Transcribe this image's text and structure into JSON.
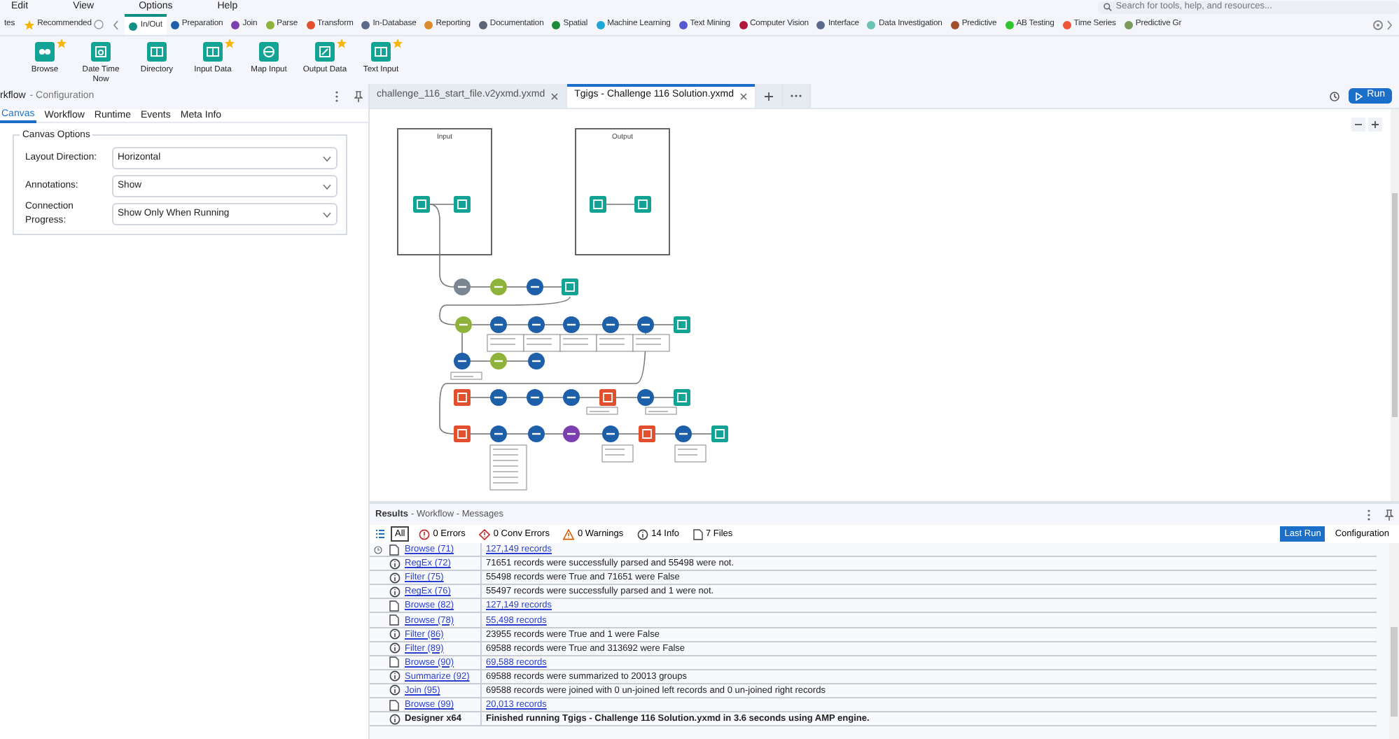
{
  "menu": [
    "Edit",
    "View",
    "Options",
    "Help"
  ],
  "search": {
    "placeholder": "Search for tools, help, and resources..."
  },
  "tool_categories": [
    {
      "label": "tes",
      "kind": "plain",
      "selected": false
    },
    {
      "label": "Recommended",
      "kind": "star",
      "selected": false
    },
    {
      "label": "In/Out",
      "kind": "dot",
      "color": "#0f8f86",
      "selected": true
    },
    {
      "label": "Preparation",
      "kind": "dot",
      "color": "#1d5fa8",
      "selected": false
    },
    {
      "label": "Join",
      "kind": "dot",
      "color": "#7b3fb0",
      "selected": false
    },
    {
      "label": "Parse",
      "kind": "dot",
      "color": "#8fb33a",
      "selected": false
    },
    {
      "label": "Transform",
      "kind": "dot",
      "color": "#e2502e",
      "selected": false
    },
    {
      "label": "In-Database",
      "kind": "dot",
      "color": "#5a6a8a",
      "selected": false
    },
    {
      "label": "Reporting",
      "kind": "dot",
      "color": "#e08a2e",
      "selected": false
    },
    {
      "label": "Documentation",
      "kind": "dot",
      "color": "#5b6478",
      "selected": false
    },
    {
      "label": "Spatial",
      "kind": "dot",
      "color": "#1c8a3a",
      "selected": false
    },
    {
      "label": "Machine Learning",
      "kind": "dot",
      "color": "#1ea7d6",
      "selected": false
    },
    {
      "label": "Text Mining",
      "kind": "dot",
      "color": "#5457d4",
      "selected": false
    },
    {
      "label": "Computer Vision",
      "kind": "dot",
      "color": "#b0183a",
      "selected": false
    },
    {
      "label": "Interface",
      "kind": "dot",
      "color": "#5a6a8a",
      "selected": false
    },
    {
      "label": "Data Investigation",
      "kind": "dot",
      "color": "#6cc2b5",
      "selected": false
    },
    {
      "label": "Predictive",
      "kind": "dot",
      "color": "#a0522d",
      "selected": false
    },
    {
      "label": "AB Testing",
      "kind": "dot",
      "color": "#2fc52f",
      "selected": false
    },
    {
      "label": "Time Series",
      "kind": "dot",
      "color": "#f0553a",
      "selected": false
    },
    {
      "label": "Predictive Gr",
      "kind": "dot",
      "color": "#7a9a5a",
      "selected": false
    }
  ],
  "ribbon_tools": [
    {
      "label": "Browse",
      "favorite": true
    },
    {
      "label": "Date Time Now",
      "favorite": false
    },
    {
      "label": "Directory",
      "favorite": false
    },
    {
      "label": "Input Data",
      "favorite": true
    },
    {
      "label": "Map Input",
      "favorite": false
    },
    {
      "label": "Output Data",
      "favorite": true
    },
    {
      "label": "Text Input",
      "favorite": true
    }
  ],
  "config_panel": {
    "title": "rkflow",
    "subtitle": "- Configuration",
    "tabs": [
      {
        "label": "Canvas",
        "selected": true
      },
      {
        "label": "Workflow",
        "selected": false
      },
      {
        "label": "Runtime",
        "selected": false
      },
      {
        "label": "Events",
        "selected": false
      },
      {
        "label": "Meta Info",
        "selected": false
      }
    ],
    "group_title": "Canvas Options",
    "fields": [
      {
        "label": "Layout Direction:",
        "value": "Horizontal"
      },
      {
        "label": "Annotations:",
        "value": "Show"
      },
      {
        "label": "Connection Progress:",
        "value": "Show Only When Running"
      }
    ]
  },
  "doc_tabs": [
    {
      "label": "challenge_116_start_file.v2yxmd.yxmd",
      "selected": false
    },
    {
      "label": "Tgigs - Challenge 116 Solution.yxmd",
      "selected": true
    }
  ],
  "run_button": "Run",
  "canvas": {
    "containers": [
      {
        "title": "Input"
      },
      {
        "title": "Output"
      }
    ]
  },
  "results": {
    "title": "Results",
    "breadcrumb": "- Workflow - Messages",
    "filters": [
      {
        "label": "All",
        "kind": "all",
        "selected": true
      },
      {
        "label": "0 Errors",
        "kind": "error",
        "selected": false
      },
      {
        "label": "0 Conv Errors",
        "kind": "conv",
        "selected": false
      },
      {
        "label": "0 Warnings",
        "kind": "warning",
        "selected": false
      },
      {
        "label": "14 Info",
        "kind": "info",
        "selected": false
      },
      {
        "label": "7 Files",
        "kind": "file",
        "selected": false
      }
    ],
    "views": [
      {
        "label": "Last Run",
        "selected": true
      },
      {
        "label": "Configuration",
        "selected": false
      }
    ],
    "rows": [
      {
        "kind": "file",
        "pinned": true,
        "tool": "Browse (71)",
        "message": "127,149 records",
        "link": true,
        "emphasis": false
      },
      {
        "kind": "info",
        "pinned": false,
        "tool": "RegEx (72)",
        "message": "71651 records were successfully parsed and 55498 were not.",
        "link": false,
        "emphasis": false
      },
      {
        "kind": "info",
        "pinned": false,
        "tool": "Filter (75)",
        "message": "55498 records were True and 71651 were False",
        "link": false,
        "emphasis": false
      },
      {
        "kind": "info",
        "pinned": false,
        "tool": "RegEx (76)",
        "message": "55497 records were successfully parsed and 1 were not.",
        "link": false,
        "emphasis": false
      },
      {
        "kind": "file",
        "pinned": false,
        "tool": "Browse (82)",
        "message": "127,149 records",
        "link": true,
        "emphasis": false
      },
      {
        "kind": "file",
        "pinned": false,
        "tool": "Browse (78)",
        "message": "55,498 records",
        "link": true,
        "emphasis": false
      },
      {
        "kind": "info",
        "pinned": false,
        "tool": "Filter (86)",
        "message": "23955 records were True and 1 were False",
        "link": false,
        "emphasis": false
      },
      {
        "kind": "info",
        "pinned": false,
        "tool": "Filter (89)",
        "message": "69588 records were True and 313692 were False",
        "link": false,
        "emphasis": false
      },
      {
        "kind": "file",
        "pinned": false,
        "tool": "Browse (90)",
        "message": "69,588 records",
        "link": true,
        "emphasis": false
      },
      {
        "kind": "info",
        "pinned": false,
        "tool": "Summarize (92)",
        "message": "69588 records were summarized to 20013 groups",
        "link": false,
        "emphasis": false
      },
      {
        "kind": "info",
        "pinned": false,
        "tool": "Join (95)",
        "message": "69588 records were joined with 0 un-joined left records and 0 un-joined right records",
        "link": false,
        "emphasis": false
      },
      {
        "kind": "file",
        "pinned": false,
        "tool": "Browse (99)",
        "message": "20,013 records",
        "link": true,
        "emphasis": false
      },
      {
        "kind": "info",
        "pinned": false,
        "tool": "Designer x64",
        "message": "Finished running Tgigs - Challenge 116 Solution.yxmd in 3.6 seconds using AMP engine.",
        "link": false,
        "emphasis": true
      }
    ]
  }
}
